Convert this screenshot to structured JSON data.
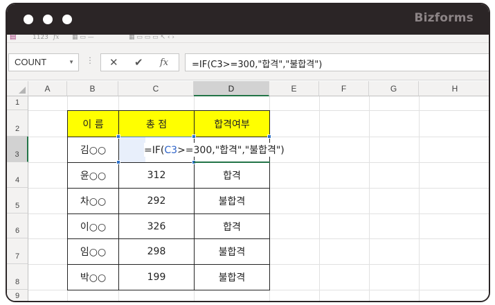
{
  "window": {
    "brand": "Bizforms"
  },
  "ribbon": {
    "fragments": [
      "1123",
      "fx"
    ]
  },
  "formula_bar": {
    "name_box": "COUNT",
    "cancel_symbol": "✕",
    "enter_symbol": "✔",
    "fx_label": "fx",
    "formula": "=IF(C3>=300,\"합격\",\"불합격\")"
  },
  "sheet": {
    "columns": [
      "A",
      "B",
      "C",
      "D",
      "E",
      "F",
      "G",
      "H"
    ],
    "rows": [
      "1",
      "2",
      "3",
      "4",
      "5",
      "6",
      "7",
      "8",
      "9"
    ],
    "selected_column": "D",
    "selected_row": "3",
    "table": {
      "headers": [
        "이 름",
        "총 점",
        "합격여부"
      ],
      "rows": [
        {
          "name": "김○○",
          "score": "",
          "result": ""
        },
        {
          "name": "윤○○",
          "score": "312",
          "result": "합격"
        },
        {
          "name": "차○○",
          "score": "292",
          "result": "불합격"
        },
        {
          "name": "이○○",
          "score": "326",
          "result": "합격"
        },
        {
          "name": "임○○",
          "score": "298",
          "result": "불합격"
        },
        {
          "name": "박○○",
          "score": "199",
          "result": "불합격"
        }
      ]
    },
    "editing": {
      "prefix": "=IF(",
      "ref": "C3",
      "suffix": ">=300,\"합격\",\"불합격\")"
    }
  },
  "colors": {
    "accent": "#217346",
    "header_fill": "#ffff00",
    "titlebar": "#2b2526"
  }
}
